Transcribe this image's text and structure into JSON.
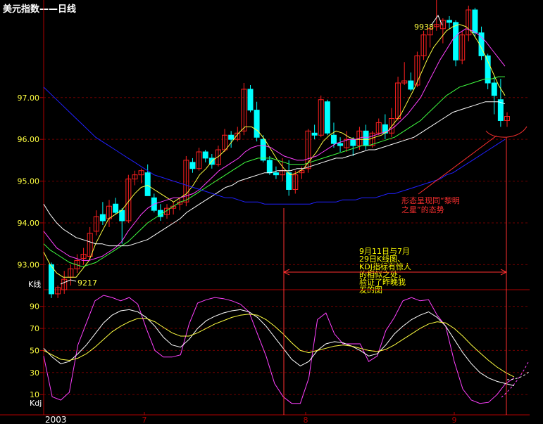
{
  "title": "美元指数——日线",
  "kline_panel": {
    "label": "K线",
    "ylim": [
      92.4,
      99.0
    ],
    "yticks": [
      "93.00",
      "94.00",
      "95.00",
      "96.00",
      "97.00"
    ],
    "high_label": "9938",
    "low_label": "9217",
    "high_value": 99.38,
    "low_value": 92.17
  },
  "kdj_panel": {
    "label": "Kdj",
    "ylim": [
      -2,
      100
    ],
    "yticks": [
      "10",
      "30",
      "50",
      "70",
      "90"
    ]
  },
  "x_axis": {
    "start_label": "2003",
    "month_ticks": [
      "7",
      "8",
      "9"
    ]
  },
  "annotations": {
    "kdj_comparison": "9月11日与7月\n29日K线图、\nKDJ指标有惊人\n的相似之处，\n验证了昨晚我\n发的图",
    "morning_star": "形态呈现同“黎明\n之星”的态势"
  },
  "colors": {
    "background": "#000000",
    "axis": "#b00000",
    "grid": "#6e0000",
    "up_candle": "#ff2020",
    "down_candle": "#00ffff",
    "ma_short": "#ffff40",
    "ma_mid": "#ff40ff",
    "ma_long1": "#40ff40",
    "ma_long2": "#ffffff",
    "ma_long3": "#2020ff",
    "k_line": "#ffffff",
    "d_line": "#ffff40",
    "j_line": "#ff40ff",
    "annotation_red": "#ff3030",
    "annotation_yellow": "#ffff00"
  },
  "chart_data": {
    "type": "candlestick",
    "ohlc": [
      [
        93.0,
        93.05,
        92.2,
        92.3
      ],
      [
        92.3,
        92.5,
        92.2,
        92.45
      ],
      [
        92.4,
        92.85,
        92.3,
        92.65
      ],
      [
        92.7,
        93.0,
        92.5,
        92.9
      ],
      [
        92.9,
        93.25,
        92.8,
        93.1
      ],
      [
        93.15,
        93.4,
        93.0,
        93.25
      ],
      [
        93.2,
        93.9,
        93.1,
        93.75
      ],
      [
        93.8,
        94.3,
        93.7,
        94.15
      ],
      [
        94.2,
        94.5,
        93.95,
        94.05
      ],
      [
        94.1,
        94.55,
        93.9,
        94.4
      ],
      [
        94.45,
        94.6,
        94.2,
        94.25
      ],
      [
        94.3,
        94.35,
        93.5,
        94.05
      ],
      [
        94.05,
        95.15,
        94.0,
        95.05
      ],
      [
        95.05,
        95.25,
        94.9,
        95.15
      ],
      [
        95.15,
        95.3,
        94.95,
        95.25
      ],
      [
        95.2,
        95.4,
        94.7,
        94.65
      ],
      [
        94.6,
        94.7,
        94.25,
        94.3
      ],
      [
        94.3,
        94.45,
        94.05,
        94.15
      ],
      [
        94.2,
        94.45,
        94.1,
        94.35
      ],
      [
        94.35,
        94.5,
        94.2,
        94.4
      ],
      [
        94.45,
        94.6,
        94.3,
        94.5
      ],
      [
        94.5,
        95.6,
        94.4,
        95.5
      ],
      [
        95.45,
        95.55,
        95.2,
        95.3
      ],
      [
        95.3,
        95.8,
        95.25,
        95.7
      ],
      [
        95.7,
        95.75,
        95.45,
        95.55
      ],
      [
        95.55,
        95.65,
        95.3,
        95.4
      ],
      [
        95.4,
        95.85,
        95.35,
        95.75
      ],
      [
        95.75,
        96.25,
        95.7,
        96.1
      ],
      [
        96.1,
        96.2,
        95.8,
        96.0
      ],
      [
        96.0,
        96.3,
        95.95,
        96.15
      ],
      [
        96.2,
        97.35,
        96.1,
        97.2
      ],
      [
        97.2,
        97.3,
        96.65,
        96.7
      ],
      [
        96.7,
        96.9,
        95.95,
        96.05
      ],
      [
        96.0,
        96.1,
        95.45,
        95.5
      ],
      [
        95.5,
        95.6,
        95.15,
        95.2
      ],
      [
        95.2,
        95.35,
        95.05,
        95.15
      ],
      [
        95.15,
        95.55,
        95.0,
        95.25
      ],
      [
        95.2,
        95.5,
        94.65,
        94.8
      ],
      [
        94.8,
        95.25,
        94.7,
        95.15
      ],
      [
        95.2,
        95.35,
        95.05,
        95.25
      ],
      [
        95.3,
        96.25,
        95.2,
        96.2
      ],
      [
        96.15,
        96.35,
        96.0,
        96.1
      ],
      [
        96.1,
        97.05,
        96.05,
        96.95
      ],
      [
        96.9,
        96.95,
        96.1,
        96.15
      ],
      [
        96.1,
        96.4,
        95.8,
        95.9
      ],
      [
        95.9,
        96.05,
        95.7,
        95.85
      ],
      [
        95.8,
        96.2,
        95.7,
        96.0
      ],
      [
        96.0,
        96.05,
        95.6,
        95.85
      ],
      [
        95.85,
        96.3,
        95.75,
        96.2
      ],
      [
        96.2,
        96.35,
        95.75,
        95.85
      ],
      [
        95.85,
        96.2,
        95.8,
        96.15
      ],
      [
        96.15,
        96.5,
        96.1,
        96.4
      ],
      [
        96.35,
        96.6,
        96.0,
        96.15
      ],
      [
        96.15,
        96.75,
        96.05,
        96.5
      ],
      [
        96.5,
        97.5,
        96.45,
        97.35
      ],
      [
        97.35,
        97.85,
        97.3,
        97.4
      ],
      [
        97.4,
        97.6,
        97.15,
        97.2
      ],
      [
        97.3,
        98.1,
        97.25,
        98.0
      ],
      [
        98.0,
        98.6,
        97.9,
        98.5
      ],
      [
        98.5,
        98.7,
        98.2,
        98.65
      ],
      [
        98.7,
        99.38,
        98.6,
        98.75
      ],
      [
        98.65,
        98.9,
        98.3,
        98.85
      ],
      [
        98.85,
        98.95,
        98.65,
        98.8
      ],
      [
        98.8,
        98.85,
        97.75,
        97.9
      ],
      [
        97.9,
        98.6,
        97.8,
        98.5
      ],
      [
        98.5,
        99.2,
        98.35,
        99.1
      ],
      [
        99.1,
        99.15,
        98.45,
        98.55
      ],
      [
        98.55,
        98.7,
        97.9,
        98.0
      ],
      [
        98.0,
        98.05,
        97.2,
        97.35
      ],
      [
        97.35,
        97.5,
        96.6,
        97.05
      ],
      [
        96.95,
        97.45,
        96.3,
        96.45
      ],
      [
        96.45,
        96.65,
        96.3,
        96.55
      ]
    ],
    "ma": [
      {
        "values": [
          93.3,
          93.0,
          92.8,
          92.7,
          92.7,
          92.7,
          92.9,
          93.1,
          93.5,
          93.8,
          94.1,
          94.2,
          94.3,
          94.5,
          94.7,
          94.85,
          94.9,
          94.8,
          94.7,
          94.6,
          94.5,
          94.6,
          94.7,
          94.9,
          95.15,
          95.3,
          95.5,
          95.6,
          95.75,
          95.95,
          96.15,
          96.3,
          96.3,
          96.2,
          96.0,
          95.75,
          95.5,
          95.3,
          95.15,
          95.2,
          95.3,
          95.5,
          95.7,
          95.95,
          96.1,
          96.2,
          96.15,
          96.05,
          96.0,
          96.0,
          96.0,
          96.05,
          96.1,
          96.2,
          96.4,
          96.6,
          96.9,
          97.2,
          97.55,
          97.9,
          98.2,
          98.4,
          98.6,
          98.7,
          98.75,
          98.7,
          98.55,
          98.3,
          98.0,
          97.65,
          97.3,
          97.05
        ]
      },
      {
        "values": [
          93.8,
          93.6,
          93.4,
          93.3,
          93.2,
          93.15,
          93.1,
          93.1,
          93.15,
          93.2,
          93.3,
          93.4,
          93.55,
          93.8,
          94.0,
          94.2,
          94.35,
          94.45,
          94.5,
          94.55,
          94.6,
          94.6,
          94.65,
          94.7,
          94.8,
          94.95,
          95.1,
          95.25,
          95.35,
          95.45,
          95.55,
          95.7,
          95.8,
          95.85,
          95.85,
          95.8,
          95.7,
          95.6,
          95.55,
          95.5,
          95.5,
          95.55,
          95.6,
          95.7,
          95.8,
          95.9,
          95.95,
          96.0,
          96.0,
          96.05,
          96.05,
          96.1,
          96.15,
          96.2,
          96.3,
          96.45,
          96.6,
          96.8,
          97.0,
          97.3,
          97.6,
          97.9,
          98.15,
          98.4,
          98.55,
          98.65,
          98.6,
          98.5,
          98.35,
          98.15,
          97.95,
          97.75
        ]
      },
      {
        "values": [
          93.5,
          93.35,
          93.25,
          93.15,
          93.05,
          93.0,
          92.95,
          93.0,
          93.05,
          93.15,
          93.25,
          93.35,
          93.45,
          93.55,
          93.7,
          93.85,
          94.0,
          94.1,
          94.2,
          94.3,
          94.4,
          94.5,
          94.55,
          94.65,
          94.75,
          94.85,
          94.95,
          95.05,
          95.15,
          95.25,
          95.35,
          95.45,
          95.5,
          95.55,
          95.55,
          95.55,
          95.5,
          95.45,
          95.4,
          95.4,
          95.4,
          95.45,
          95.5,
          95.55,
          95.6,
          95.65,
          95.7,
          95.75,
          95.8,
          95.85,
          95.85,
          95.9,
          95.95,
          96.0,
          96.05,
          96.15,
          96.25,
          96.35,
          96.45,
          96.6,
          96.75,
          96.9,
          97.05,
          97.15,
          97.25,
          97.3,
          97.35,
          97.4,
          97.45,
          97.45,
          97.5,
          97.5
        ]
      },
      {
        "values": [
          94.45,
          94.2,
          94.0,
          93.85,
          93.75,
          93.65,
          93.6,
          93.55,
          93.5,
          93.5,
          93.45,
          93.45,
          93.45,
          93.45,
          93.5,
          93.55,
          93.6,
          93.7,
          93.8,
          93.9,
          94.0,
          94.1,
          94.25,
          94.35,
          94.45,
          94.55,
          94.65,
          94.75,
          94.85,
          94.9,
          95.0,
          95.05,
          95.1,
          95.15,
          95.2,
          95.2,
          95.25,
          95.25,
          95.25,
          95.3,
          95.3,
          95.35,
          95.4,
          95.45,
          95.5,
          95.55,
          95.55,
          95.6,
          95.65,
          95.7,
          95.75,
          95.75,
          95.8,
          95.85,
          95.9,
          95.95,
          96.0,
          96.05,
          96.15,
          96.25,
          96.35,
          96.45,
          96.55,
          96.65,
          96.7,
          96.75,
          96.8,
          96.85,
          96.9,
          96.9,
          96.9,
          96.85
        ]
      },
      {
        "values": [
          97.25,
          97.1,
          96.95,
          96.8,
          96.65,
          96.5,
          96.35,
          96.2,
          96.05,
          95.95,
          95.85,
          95.75,
          95.65,
          95.55,
          95.45,
          95.35,
          95.25,
          95.15,
          95.1,
          95.05,
          95.0,
          94.95,
          94.9,
          94.85,
          94.8,
          94.75,
          94.7,
          94.65,
          94.6,
          94.6,
          94.55,
          94.5,
          94.5,
          94.5,
          94.45,
          94.45,
          94.45,
          94.45,
          94.45,
          94.45,
          94.45,
          94.45,
          94.5,
          94.5,
          94.5,
          94.5,
          94.55,
          94.55,
          94.55,
          94.6,
          94.6,
          94.6,
          94.65,
          94.7,
          94.7,
          94.75,
          94.8,
          94.85,
          94.9,
          94.95,
          95.0,
          95.05,
          95.15,
          95.2,
          95.3,
          95.4,
          95.5,
          95.6,
          95.7,
          95.8,
          95.9,
          96.0
        ]
      }
    ],
    "kdj": {
      "k": [
        52,
        44,
        38,
        40,
        47,
        55,
        65,
        75,
        82,
        86,
        87,
        85,
        80,
        72,
        62,
        55,
        53,
        60,
        70,
        77,
        81,
        84,
        86,
        87,
        85,
        80,
        72,
        62,
        52,
        42,
        36,
        40,
        50,
        56,
        58,
        57,
        54,
        50,
        45,
        47,
        55,
        65,
        72,
        78,
        82,
        85,
        80,
        72,
        60,
        48,
        38,
        30,
        25,
        22,
        20,
        18
      ],
      "d": [
        50,
        46,
        42,
        41,
        43,
        47,
        53,
        60,
        67,
        72,
        76,
        79,
        79,
        76,
        71,
        66,
        63,
        63,
        66,
        70,
        74,
        77,
        80,
        82,
        83,
        82,
        78,
        72,
        65,
        57,
        50,
        48,
        50,
        52,
        54,
        55,
        54,
        52,
        50,
        49,
        51,
        55,
        60,
        65,
        70,
        74,
        76,
        75,
        70,
        63,
        55,
        48,
        41,
        35,
        30,
        26
      ],
      "j": [
        45,
        8,
        5,
        12,
        55,
        75,
        95,
        100,
        98,
        95,
        98,
        92,
        70,
        50,
        44,
        44,
        46,
        74,
        93,
        96,
        98,
        97,
        95,
        92,
        85,
        65,
        45,
        20,
        8,
        2,
        2,
        25,
        78,
        84,
        65,
        56,
        56,
        56,
        40,
        45,
        68,
        80,
        95,
        98,
        95,
        96,
        82,
        72,
        40,
        15,
        5,
        2,
        3,
        10,
        20,
        25
      ]
    }
  }
}
